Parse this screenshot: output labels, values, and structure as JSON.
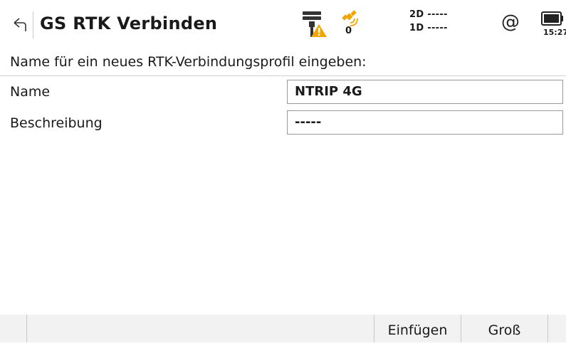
{
  "header": {
    "title": "GS RTK Verbinden",
    "satellite_count": "0",
    "quality_2d": "2D -----",
    "quality_1d": "1D -----",
    "at_symbol": "@",
    "time": "15:27"
  },
  "form": {
    "prompt": "Name für ein neues RTK-Verbindungsprofil eingeben:",
    "name_label": "Name",
    "name_value": "NTRIP 4G",
    "description_label": "Beschreibung",
    "description_value": "-----"
  },
  "function_keys": {
    "f1": "",
    "f2": "",
    "f3": "",
    "f4": "Einfügen",
    "f5": "Groß",
    "f6": ""
  },
  "colors": {
    "warning": "#f0a500",
    "satellite": "#f0a500"
  }
}
